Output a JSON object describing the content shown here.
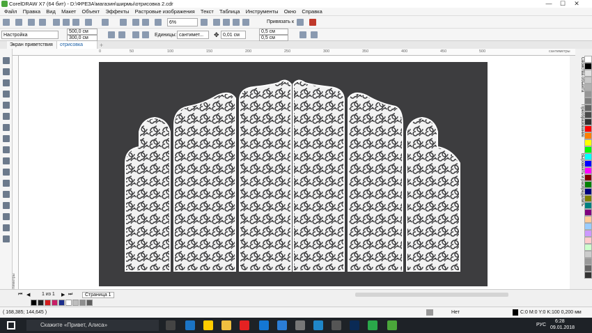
{
  "window": {
    "title": "CorelDRAW X7 (64 бит) - D:\\ФРЕЗА\\магазин\\ширмы\\отрисовка 2.cdr",
    "minimize": "—",
    "maximize": "☐",
    "close": "✕"
  },
  "menu": [
    "Файл",
    "Правка",
    "Вид",
    "Макет",
    "Объект",
    "Эффекты",
    "Растровые изображения",
    "Текст",
    "Таблица",
    "Инструменты",
    "Окно",
    "Справка"
  ],
  "toolbar": {
    "zoom": "6%",
    "snap_label": "Привязать к"
  },
  "propbar": {
    "preset": "Настройка",
    "width": "500,0 см",
    "height": "300,0 см",
    "units_label": "Единицы:",
    "units_value": "сантимет...",
    "nudge": "0,01 см",
    "dup_x": "0,5 см",
    "dup_y": "0,5 см"
  },
  "tabs": [
    {
      "label": "Экран приветствия"
    },
    {
      "label": "отрисовка 2.cdr"
    }
  ],
  "ruler": {
    "h_marks": [
      "0",
      "50",
      "100",
      "150",
      "200",
      "250",
      "300",
      "350",
      "400",
      "450",
      "500"
    ],
    "unit": "сантиметры"
  },
  "dockers": [
    "Свойства объекта",
    "Преобразование",
    "Выровнять и распределить"
  ],
  "pagenav": {
    "page_count": "1 из 1",
    "page_tab": "Страница 1"
  },
  "status": {
    "coords": "( 168,385; 144,645 )",
    "fill_label": "Нет",
    "outline": "C:0 M:0 Y:0 K:100  0,200 мм"
  },
  "taskbar": {
    "search": "Скажите «Привет, Алиса»",
    "lang": "РУС",
    "time": "6:28",
    "date": "09.01.2018"
  },
  "palette_colors": [
    "#ffffff",
    "#000000",
    "#e0e0e0",
    "#c8c8c8",
    "#b0b0b0",
    "#969696",
    "#7d7d7d",
    "#646464",
    "#4b4b4b",
    "#323232",
    "#ff0000",
    "#ff7f00",
    "#ffff00",
    "#00ff00",
    "#00ffff",
    "#0000ff",
    "#ff00ff",
    "#7f0000",
    "#007f00",
    "#00007f",
    "#7f7f00",
    "#007f7f",
    "#7f007f",
    "#ffcc99",
    "#99ccff",
    "#cc99ff",
    "#ffcccc",
    "#ccffcc",
    "#cccccc",
    "#999999",
    "#666666",
    "#333333"
  ],
  "bottom_swatches": [
    "#000000",
    "#222222",
    "#d61c1c",
    "#c81e65",
    "#1d2f8c",
    "#ffffff",
    "#bdbdbd",
    "#8f8f8f",
    "#5f5f5f"
  ]
}
